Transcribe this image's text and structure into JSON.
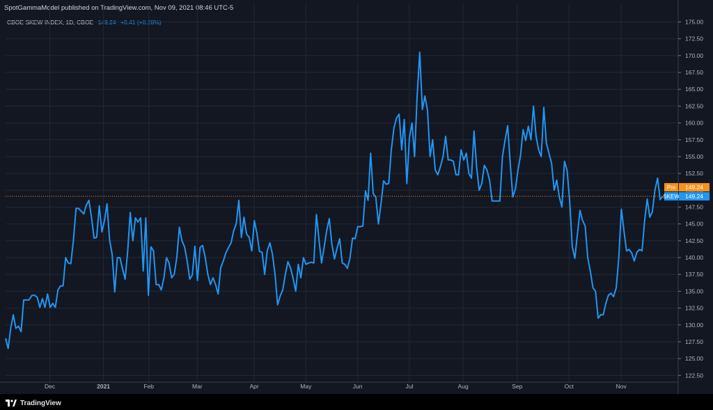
{
  "header": {
    "published": "SpotGammaModel published on TradingView.com, Nov 09, 2021 08:46 UTC-5"
  },
  "legend": {
    "symbol": "CBOE SKEW INDEX, 1D, CBOE",
    "last": "149.24",
    "change": "+0.41 (+0.28%)"
  },
  "labels": {
    "pre": {
      "name": "Pre",
      "value": "149.24",
      "color": "#f7931a"
    },
    "skew": {
      "name": "SKEW",
      "value": "149.24",
      "color": "#2196f3"
    }
  },
  "footer": {
    "brand": "TradingView"
  },
  "chart_data": {
    "type": "line",
    "ylim": [
      121.5,
      176.5
    ],
    "yticks": [
      "175.00",
      "172.50",
      "170.00",
      "167.50",
      "165.00",
      "162.50",
      "160.00",
      "157.50",
      "155.00",
      "152.50",
      "150.00",
      "147.50",
      "145.00",
      "142.50",
      "140.00",
      "137.50",
      "135.00",
      "132.50",
      "130.00",
      "127.50",
      "125.00",
      "122.50"
    ],
    "xlabels": [
      {
        "label": "Dec",
        "t": 0.0685
      },
      {
        "label": "2021",
        "t": 0.1515
      },
      {
        "label": "Feb",
        "t": 0.2216
      },
      {
        "label": "Mar",
        "t": 0.2967
      },
      {
        "label": "Apr",
        "t": 0.3848
      },
      {
        "label": "May",
        "t": 0.4648
      },
      {
        "label": "Jun",
        "t": 0.5449
      },
      {
        "label": "Jul",
        "t": 0.6249
      },
      {
        "label": "Aug",
        "t": 0.7081
      },
      {
        "label": "Sep",
        "t": 0.7918
      },
      {
        "label": "Oct",
        "t": 0.872
      },
      {
        "label": "Nov",
        "t": 0.9528
      }
    ],
    "series": [
      {
        "color": "#2196f3",
        "points": [
          [
            0.0,
            128.0
          ],
          [
            0.004,
            126.5
          ],
          [
            0.008,
            129.5
          ],
          [
            0.012,
            131.5
          ],
          [
            0.016,
            129.5
          ],
          [
            0.02,
            129.8
          ],
          [
            0.024,
            129.0
          ],
          [
            0.028,
            133.7
          ],
          [
            0.032,
            133.7
          ],
          [
            0.036,
            133.7
          ],
          [
            0.041,
            134.4
          ],
          [
            0.045,
            134.4
          ],
          [
            0.049,
            134.1
          ],
          [
            0.053,
            132.6
          ],
          [
            0.057,
            133.9
          ],
          [
            0.061,
            132.6
          ],
          [
            0.065,
            134.6
          ],
          [
            0.069,
            132.6
          ],
          [
            0.073,
            133.2
          ],
          [
            0.077,
            132.6
          ],
          [
            0.081,
            135.2
          ],
          [
            0.085,
            135.8
          ],
          [
            0.089,
            135.8
          ],
          [
            0.093,
            140.0
          ],
          [
            0.097,
            139.2
          ],
          [
            0.101,
            139.1
          ],
          [
            0.105,
            142.5
          ],
          [
            0.109,
            147.3
          ],
          [
            0.113,
            147.3
          ],
          [
            0.117,
            146.9
          ],
          [
            0.121,
            146.5
          ],
          [
            0.125,
            147.8
          ],
          [
            0.129,
            148.5
          ],
          [
            0.133,
            146.0
          ],
          [
            0.137,
            142.9
          ],
          [
            0.141,
            143.0
          ],
          [
            0.145,
            147.7
          ],
          [
            0.149,
            143.8
          ],
          [
            0.153,
            145.5
          ],
          [
            0.157,
            148.0
          ],
          [
            0.161,
            142.6
          ],
          [
            0.165,
            140.5
          ],
          [
            0.169,
            134.9
          ],
          [
            0.173,
            140.0
          ],
          [
            0.177,
            140.0
          ],
          [
            0.181,
            138.3
          ],
          [
            0.185,
            136.8
          ],
          [
            0.189,
            141.0
          ],
          [
            0.193,
            146.7
          ],
          [
            0.197,
            142.5
          ],
          [
            0.201,
            145.9
          ],
          [
            0.205,
            145.3
          ],
          [
            0.209,
            145.9
          ],
          [
            0.213,
            138.0
          ],
          [
            0.217,
            145.9
          ],
          [
            0.221,
            134.4
          ],
          [
            0.225,
            141.6
          ],
          [
            0.229,
            141.0
          ],
          [
            0.233,
            136.0
          ],
          [
            0.237,
            136.0
          ],
          [
            0.241,
            135.2
          ],
          [
            0.245,
            137.0
          ],
          [
            0.249,
            140.0
          ],
          [
            0.253,
            139.2
          ],
          [
            0.257,
            137.0
          ],
          [
            0.261,
            137.5
          ],
          [
            0.265,
            140.0
          ],
          [
            0.269,
            144.5
          ],
          [
            0.273,
            142.5
          ],
          [
            0.277,
            141.6
          ],
          [
            0.281,
            139.5
          ],
          [
            0.285,
            136.8
          ],
          [
            0.289,
            137.4
          ],
          [
            0.293,
            141.7
          ],
          [
            0.297,
            136.6
          ],
          [
            0.301,
            141.5
          ],
          [
            0.305,
            141.8
          ],
          [
            0.309,
            140.0
          ],
          [
            0.313,
            137.5
          ],
          [
            0.317,
            136.0
          ],
          [
            0.321,
            137.0
          ],
          [
            0.325,
            136.0
          ],
          [
            0.329,
            134.6
          ],
          [
            0.333,
            138.5
          ],
          [
            0.337,
            139.5
          ],
          [
            0.341,
            140.7
          ],
          [
            0.345,
            141.5
          ],
          [
            0.349,
            142.2
          ],
          [
            0.353,
            144.0
          ],
          [
            0.357,
            145.0
          ],
          [
            0.361,
            148.5
          ],
          [
            0.365,
            143.0
          ],
          [
            0.369,
            146.0
          ],
          [
            0.373,
            143.5
          ],
          [
            0.377,
            143.0
          ],
          [
            0.381,
            141.0
          ],
          [
            0.385,
            145.5
          ],
          [
            0.389,
            143.6
          ],
          [
            0.393,
            140.9
          ],
          [
            0.397,
            140.8
          ],
          [
            0.401,
            137.5
          ],
          [
            0.405,
            141.0
          ],
          [
            0.409,
            142.2
          ],
          [
            0.413,
            140.5
          ],
          [
            0.417,
            137.5
          ],
          [
            0.421,
            133.0
          ],
          [
            0.425,
            134.3
          ],
          [
            0.429,
            135.2
          ],
          [
            0.433,
            137.5
          ],
          [
            0.437,
            139.4
          ],
          [
            0.441,
            138.5
          ],
          [
            0.445,
            136.9
          ],
          [
            0.449,
            135.0
          ],
          [
            0.453,
            139.0
          ],
          [
            0.457,
            137.0
          ],
          [
            0.461,
            140.0
          ],
          [
            0.465,
            139.0
          ],
          [
            0.469,
            139.2
          ],
          [
            0.473,
            139.3
          ],
          [
            0.477,
            139.2
          ],
          [
            0.481,
            146.4
          ],
          [
            0.485,
            142.7
          ],
          [
            0.489,
            139.2
          ],
          [
            0.493,
            141.5
          ],
          [
            0.497,
            144.0
          ],
          [
            0.501,
            145.8
          ],
          [
            0.505,
            142.0
          ],
          [
            0.509,
            139.8
          ],
          [
            0.513,
            141.4
          ],
          [
            0.517,
            142.8
          ],
          [
            0.521,
            139.2
          ],
          [
            0.525,
            139.0
          ],
          [
            0.529,
            138.4
          ],
          [
            0.533,
            139.9
          ],
          [
            0.537,
            142.9
          ],
          [
            0.541,
            142.8
          ],
          [
            0.545,
            144.6
          ],
          [
            0.549,
            144.6
          ],
          [
            0.553,
            144.7
          ],
          [
            0.557,
            149.9
          ],
          [
            0.561,
            148.5
          ],
          [
            0.565,
            155.5
          ],
          [
            0.569,
            149.5
          ],
          [
            0.573,
            149.0
          ],
          [
            0.577,
            145.0
          ],
          [
            0.581,
            148.0
          ],
          [
            0.585,
            151.4
          ],
          [
            0.589,
            150.9
          ],
          [
            0.593,
            151.0
          ],
          [
            0.597,
            156.0
          ],
          [
            0.601,
            159.2
          ],
          [
            0.605,
            160.7
          ],
          [
            0.609,
            161.3
          ],
          [
            0.613,
            156.0
          ],
          [
            0.617,
            160.5
          ],
          [
            0.621,
            151.0
          ],
          [
            0.625,
            157.8
          ],
          [
            0.629,
            160.0
          ],
          [
            0.633,
            155.0
          ],
          [
            0.637,
            164.0
          ],
          [
            0.641,
            170.5
          ],
          [
            0.645,
            162.0
          ],
          [
            0.649,
            164.0
          ],
          [
            0.653,
            161.8
          ],
          [
            0.657,
            155.0
          ],
          [
            0.661,
            157.5
          ],
          [
            0.665,
            153.0
          ],
          [
            0.669,
            152.3
          ],
          [
            0.673,
            153.5
          ],
          [
            0.677,
            155.0
          ],
          [
            0.681,
            158.0
          ],
          [
            0.685,
            154.5
          ],
          [
            0.689,
            154.5
          ],
          [
            0.693,
            154.3
          ],
          [
            0.697,
            152.3
          ],
          [
            0.701,
            152.3
          ],
          [
            0.705,
            156.0
          ],
          [
            0.709,
            154.5
          ],
          [
            0.713,
            155.5
          ],
          [
            0.717,
            152.5
          ],
          [
            0.721,
            151.8
          ],
          [
            0.725,
            158.8
          ],
          [
            0.729,
            153.5
          ],
          [
            0.733,
            150.0
          ],
          [
            0.737,
            151.0
          ],
          [
            0.741,
            153.7
          ],
          [
            0.745,
            153.0
          ],
          [
            0.749,
            151.5
          ],
          [
            0.753,
            148.4
          ],
          [
            0.757,
            148.4
          ],
          [
            0.761,
            148.4
          ],
          [
            0.765,
            148.4
          ],
          [
            0.769,
            155.0
          ],
          [
            0.773,
            157.4
          ],
          [
            0.777,
            159.6
          ],
          [
            0.781,
            154.0
          ],
          [
            0.785,
            149.0
          ],
          [
            0.789,
            150.2
          ],
          [
            0.793,
            153.0
          ],
          [
            0.797,
            155.2
          ],
          [
            0.801,
            159.0
          ],
          [
            0.805,
            157.4
          ],
          [
            0.809,
            159.5
          ],
          [
            0.813,
            157.5
          ],
          [
            0.817,
            162.5
          ],
          [
            0.821,
            158.0
          ],
          [
            0.825,
            156.0
          ],
          [
            0.829,
            155.0
          ],
          [
            0.833,
            162.3
          ],
          [
            0.837,
            157.0
          ],
          [
            0.841,
            155.5
          ],
          [
            0.845,
            154.0
          ],
          [
            0.849,
            150.0
          ],
          [
            0.853,
            151.5
          ],
          [
            0.857,
            149.0
          ],
          [
            0.861,
            147.5
          ],
          [
            0.865,
            154.3
          ],
          [
            0.869,
            153.0
          ],
          [
            0.873,
            148.5
          ],
          [
            0.877,
            141.6
          ],
          [
            0.881,
            139.9
          ],
          [
            0.885,
            143.5
          ],
          [
            0.889,
            147.0
          ],
          [
            0.893,
            145.5
          ],
          [
            0.897,
            144.7
          ],
          [
            0.901,
            140.0
          ],
          [
            0.905,
            138.0
          ],
          [
            0.909,
            135.5
          ],
          [
            0.913,
            135.0
          ],
          [
            0.917,
            131.0
          ],
          [
            0.921,
            131.5
          ],
          [
            0.925,
            131.5
          ],
          [
            0.929,
            133.2
          ],
          [
            0.933,
            134.4
          ],
          [
            0.937,
            134.7
          ],
          [
            0.941,
            134.2
          ],
          [
            0.945,
            135.5
          ],
          [
            0.949,
            140.0
          ],
          [
            0.953,
            147.2
          ],
          [
            0.957,
            144.0
          ],
          [
            0.961,
            141.0
          ],
          [
            0.965,
            141.2
          ],
          [
            0.969,
            140.7
          ],
          [
            0.973,
            139.5
          ],
          [
            0.977,
            140.8
          ],
          [
            0.981,
            141.2
          ],
          [
            0.985,
            141.0
          ],
          [
            0.989,
            145.5
          ],
          [
            0.993,
            148.7
          ],
          [
            0.997,
            146.0
          ],
          [
            1.001,
            146.8
          ],
          [
            1.005,
            150.0
          ],
          [
            1.009,
            151.8
          ],
          [
            1.013,
            148.6
          ],
          [
            1.017,
            149.1
          ]
        ]
      }
    ]
  }
}
